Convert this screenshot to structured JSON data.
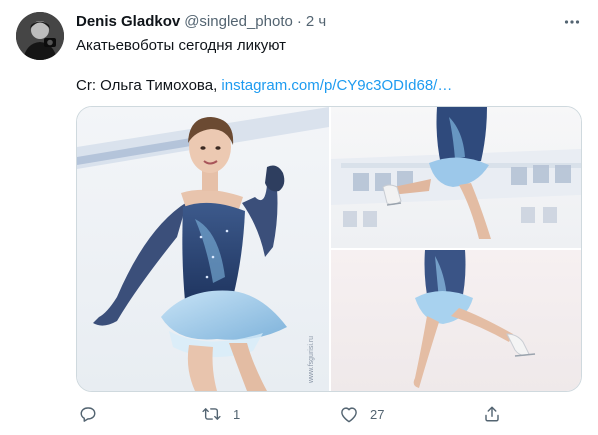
{
  "tweet": {
    "author_name": "Denis Gladkov",
    "author_handle": "@singled_photo",
    "separator": "·",
    "time": "2 ч",
    "text_line1": "Акатьевоботы сегодня ликуют",
    "text_line2_prefix": "Cr: Ольга Тимохова, ",
    "text_line2_link": "instagram.com/p/CY9c3ODId68/…",
    "media_watermark": "www.fsgurisi.ru",
    "stats": {
      "replies": "",
      "retweets": "1",
      "likes": "27"
    }
  },
  "icons": {
    "more": "more-dots-icon",
    "reply": "reply-bubble-icon",
    "retweet": "retweet-icon",
    "like": "heart-icon",
    "share": "share-icon"
  },
  "colors": {
    "text_primary": "#0f1419",
    "text_secondary": "#536471",
    "link": "#1d9bf0",
    "border": "#cfd9de"
  }
}
